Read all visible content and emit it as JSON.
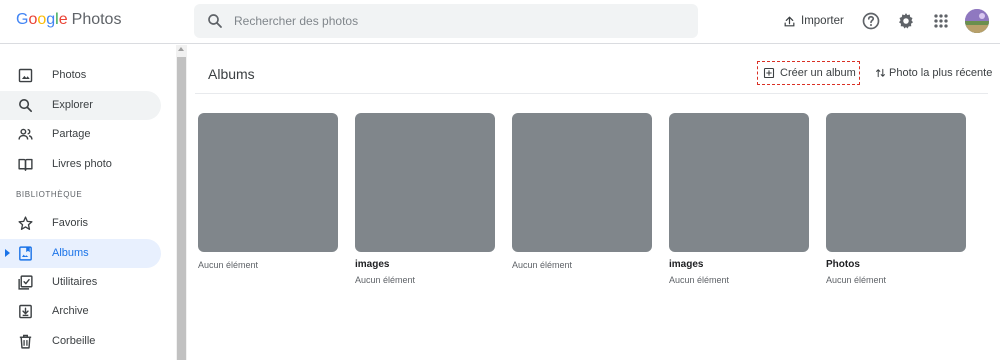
{
  "app": {
    "logo_letters": [
      "G",
      "o",
      "o",
      "g",
      "l",
      "e"
    ],
    "product_name": "Photos"
  },
  "search": {
    "placeholder": "Rechercher des photos"
  },
  "header": {
    "import_label": "Importer",
    "icons": [
      "upload-icon",
      "help-icon",
      "settings-icon",
      "apps-icon",
      "account-avatar"
    ]
  },
  "sidebar": {
    "items": [
      {
        "label": "Photos",
        "icon": "photo-icon"
      },
      {
        "label": "Explorer",
        "icon": "search-icon"
      },
      {
        "label": "Partage",
        "icon": "people-icon"
      },
      {
        "label": "Livres photo",
        "icon": "book-icon"
      }
    ],
    "section_label": "BIBLIOTHÈQUE",
    "library_items": [
      {
        "label": "Favoris",
        "icon": "star-icon"
      },
      {
        "label": "Albums",
        "icon": "album-icon"
      },
      {
        "label": "Utilitaires",
        "icon": "utilities-icon"
      },
      {
        "label": "Archive",
        "icon": "archive-icon"
      },
      {
        "label": "Corbeille",
        "icon": "trash-icon"
      }
    ]
  },
  "main": {
    "title": "Albums",
    "create_album_label": "Créer un album",
    "sort_label": "Photo la plus récente",
    "albums": [
      {
        "name": "",
        "count": "Aucun élément"
      },
      {
        "name": "images",
        "count": "Aucun élément"
      },
      {
        "name": "",
        "count": "Aucun élément"
      },
      {
        "name": "images",
        "count": "Aucun élément"
      },
      {
        "name": "Photos",
        "count": "Aucun élément"
      }
    ]
  },
  "colors": {
    "accent": "#1a73e8",
    "active_bg": "#e8f0fe",
    "thumb_gray": "#80868b",
    "highlight_border": "#d93025"
  }
}
